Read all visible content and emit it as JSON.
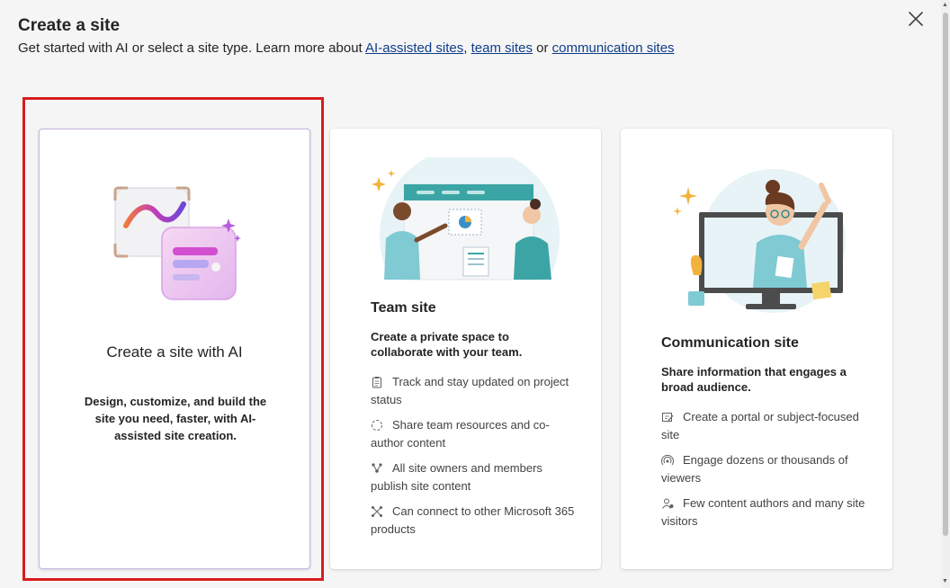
{
  "header": {
    "title": "Create a site",
    "subtitle_prefix": "Get started with AI or select a site type. Learn more about ",
    "link_ai": "AI-assisted sites",
    "sep1": ", ",
    "link_team": "team sites",
    "sep2": " or ",
    "link_comm": "communication sites"
  },
  "cards": {
    "ai": {
      "title": "Create a site with AI",
      "description": "Design, customize, and build the site you need, faster, with AI-assisted site creation."
    },
    "team": {
      "title": "Team site",
      "description": "Create a private space to collaborate with your team.",
      "features": [
        {
          "icon": "clipboard-icon",
          "text": "Track and stay updated on project status"
        },
        {
          "icon": "share-circle-icon",
          "text": "Share team resources and co-author content"
        },
        {
          "icon": "people-network-icon",
          "text": "All site owners and members publish site content"
        },
        {
          "icon": "connect-icon",
          "text": "Can connect to other Microsoft 365 products"
        }
      ]
    },
    "comm": {
      "title": "Communication site",
      "description": "Share information that engages a broad audience.",
      "features": [
        {
          "icon": "edit-page-icon",
          "text": "Create a portal or subject-focused site"
        },
        {
          "icon": "broadcast-icon",
          "text": "Engage dozens or thousands of viewers"
        },
        {
          "icon": "people-audience-icon",
          "text": "Few content authors and many site visitors"
        }
      ]
    }
  },
  "colors": {
    "link": "#0f3d8a",
    "highlight": "#d91c1c",
    "ai_border": "#c9b8e6"
  }
}
